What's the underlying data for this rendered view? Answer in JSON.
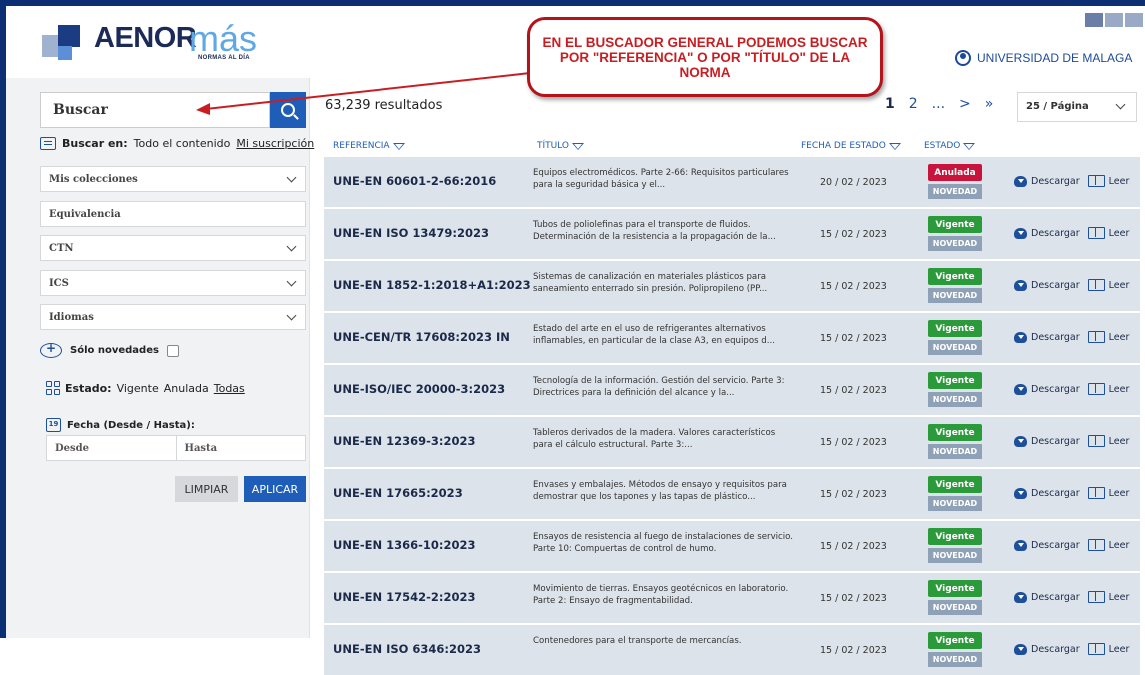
{
  "brand": {
    "name": "AENOR",
    "suffix": "más",
    "tagline": "NORMAS AL DÍA"
  },
  "user": {
    "label": "UNIVERSIDAD DE MALAGA"
  },
  "search": {
    "placeholder": "Buscar",
    "scope_label": "Buscar en:",
    "scope_all": "Todo el contenido",
    "scope_sub": "Mi suscripción"
  },
  "filters": {
    "colecciones": "Mis colecciones",
    "equivalencia": "Equivalencia",
    "ctn": "CTN",
    "ics": "ICS",
    "idiomas": "Idiomas"
  },
  "novedades": {
    "label": "Sólo novedades"
  },
  "estado": {
    "label": "Estado:",
    "vigente": "Vigente",
    "anulada": "Anulada",
    "todas": "Todas"
  },
  "fecha": {
    "label": "Fecha (Desde / Hasta):",
    "desde": "Desde",
    "hasta": "Hasta",
    "cal": "19"
  },
  "buttons": {
    "clear": "LIMPIAR",
    "apply": "APLICAR"
  },
  "results": {
    "count": "63,239 resultados"
  },
  "pager": {
    "p1": "1",
    "p2": "2",
    "dots": "...",
    "next": ">",
    "last": "»",
    "page_size": "25 / Página"
  },
  "columns": {
    "ref": "REFERENCIA",
    "title": "TÍTULO",
    "date": "FECHA DE ESTADO",
    "status": "ESTADO"
  },
  "row_actions": {
    "download": "Descargar",
    "read": "Leer",
    "novelty": "NOVEDAD"
  },
  "rows": [
    {
      "ref": "UNE-EN 60601-2-66:2016",
      "title": "Equipos electromédicos. Parte 2-66: Requisitos particulares para la seguridad básica y el...",
      "date": "20 / 02 / 2023",
      "status": "Anulada",
      "status_color": "#c8143c"
    },
    {
      "ref": "UNE-EN ISO 13479:2023",
      "title": "Tubos de poliolefinas para el transporte de fluidos. Determinación de la resistencia a la propagación de la...",
      "date": "15 / 02 / 2023",
      "status": "Vigente",
      "status_color": "#2a9a3a"
    },
    {
      "ref": "UNE-EN 1852-1:2018+A1:2023",
      "title": "Sistemas de canalización en materiales plásticos para saneamiento enterrado sin presión. Polipropileno (PP...",
      "date": "15 / 02 / 2023",
      "status": "Vigente",
      "status_color": "#2a9a3a"
    },
    {
      "ref": "UNE-CEN/TR 17608:2023 IN",
      "title": "Estado del arte en el uso de refrigerantes alternativos inflamables, en particular de la clase A3, en equipos d...",
      "date": "15 / 02 / 2023",
      "status": "Vigente",
      "status_color": "#2a9a3a"
    },
    {
      "ref": "UNE-ISO/IEC 20000-3:2023",
      "title": "Tecnología de la información. Gestión del servicio. Parte 3: Directrices para la definición del alcance y la...",
      "date": "15 / 02 / 2023",
      "status": "Vigente",
      "status_color": "#2a9a3a"
    },
    {
      "ref": "UNE-EN 12369-3:2023",
      "title": "Tableros derivados de la madera. Valores característicos para el cálculo estructural. Parte 3:...",
      "date": "15 / 02 / 2023",
      "status": "Vigente",
      "status_color": "#2a9a3a"
    },
    {
      "ref": "UNE-EN 17665:2023",
      "title": "Envases y embalajes. Métodos de ensayo y requisitos para demostrar que los tapones y las tapas de plástico...",
      "date": "15 / 02 / 2023",
      "status": "Vigente",
      "status_color": "#2a9a3a"
    },
    {
      "ref": "UNE-EN 1366-10:2023",
      "title": "Ensayos de resistencia al fuego de instalaciones de servicio. Parte 10: Compuertas de control de humo.",
      "date": "15 / 02 / 2023",
      "status": "Vigente",
      "status_color": "#2a9a3a"
    },
    {
      "ref": "UNE-EN 17542-2:2023",
      "title": "Movimiento de tierras. Ensayos geotécnicos en laboratorio. Parte 2: Ensayo de fragmentabilidad.",
      "date": "15 / 02 / 2023",
      "status": "Vigente",
      "status_color": "#2a9a3a"
    },
    {
      "ref": "UNE-EN ISO 6346:2023",
      "title": "Contenedores para el transporte de mercancías.",
      "date": "15 / 02 / 2023",
      "status": "Vigente",
      "status_color": "#2a9a3a"
    }
  ],
  "callout": {
    "text": "EN EL BUSCADOR GENERAL PODEMOS BUSCAR POR \"REFERENCIA\" O POR \"TÍTULO\" DE LA NORMA"
  },
  "colors": {
    "accent": "#1e5eb8",
    "frame": "#0c2f73",
    "callout": "#c81e22"
  }
}
